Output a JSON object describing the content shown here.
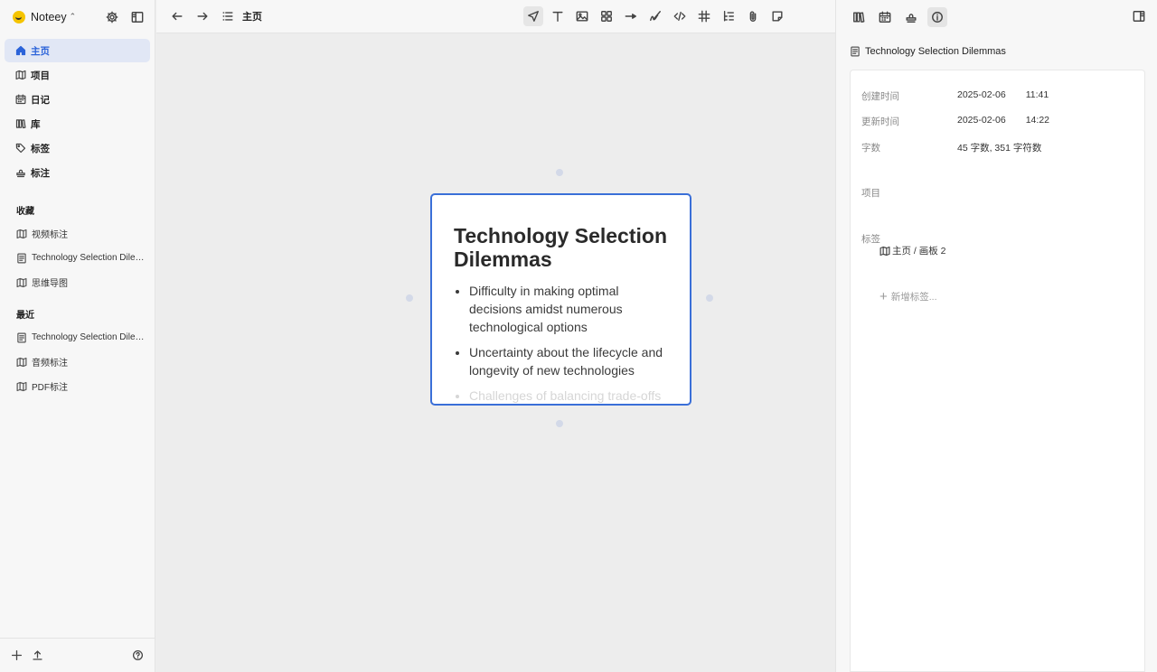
{
  "app": {
    "name": "Noteey"
  },
  "sidebar": {
    "nav": [
      {
        "label": "主页",
        "icon": "home-icon",
        "active": true
      },
      {
        "label": "项目",
        "icon": "map-icon"
      },
      {
        "label": "日记",
        "icon": "calendar-icon"
      },
      {
        "label": "库",
        "icon": "library-icon"
      },
      {
        "label": "标签",
        "icon": "tag-icon"
      },
      {
        "label": "标注",
        "icon": "stamp-icon"
      }
    ],
    "favorites_title": "收藏",
    "favorites": [
      {
        "label": "视频标注",
        "icon": "map-icon"
      },
      {
        "label": "Technology Selection Dilemmas",
        "icon": "document-icon"
      },
      {
        "label": "思维导图",
        "icon": "map-icon"
      }
    ],
    "recent_title": "最近",
    "recent": [
      {
        "label": "Technology Selection Dilemmas",
        "icon": "document-icon"
      },
      {
        "label": "音频标注",
        "icon": "map-icon"
      },
      {
        "label": "PDF标注",
        "icon": "map-icon"
      }
    ]
  },
  "toolbar": {
    "breadcrumb": "主页",
    "tools": [
      "select-tool-icon",
      "text-tool-icon",
      "image-tool-icon",
      "shapes-tool-icon",
      "arrow-tool-icon",
      "pen-tool-icon",
      "code-tool-icon",
      "grid-tool-icon",
      "list-tool-icon",
      "attachment-tool-icon",
      "sticky-note-tool-icon"
    ]
  },
  "canvas": {
    "card": {
      "title": "Technology Selection Dilemmas",
      "bullets": [
        "Difficulty in making optimal decisions amidst numerous technological options",
        "Uncertainty about the lifecycle and longevity of new technologies",
        "Challenges of balancing trade-offs between"
      ]
    }
  },
  "right_panel": {
    "doc_title": "Technology Selection Dilemmas",
    "created_label": "创建时间",
    "created_date": "2025-02-06",
    "created_time": "11:41",
    "updated_label": "更新时间",
    "updated_date": "2025-02-06",
    "updated_time": "14:22",
    "count_label": "字数",
    "count_value": "45 字数, 351 字符数",
    "project_label": "项目",
    "project_path": "主页 / 画板 2",
    "tags_label": "标签",
    "add_tag": "新增标签..."
  }
}
